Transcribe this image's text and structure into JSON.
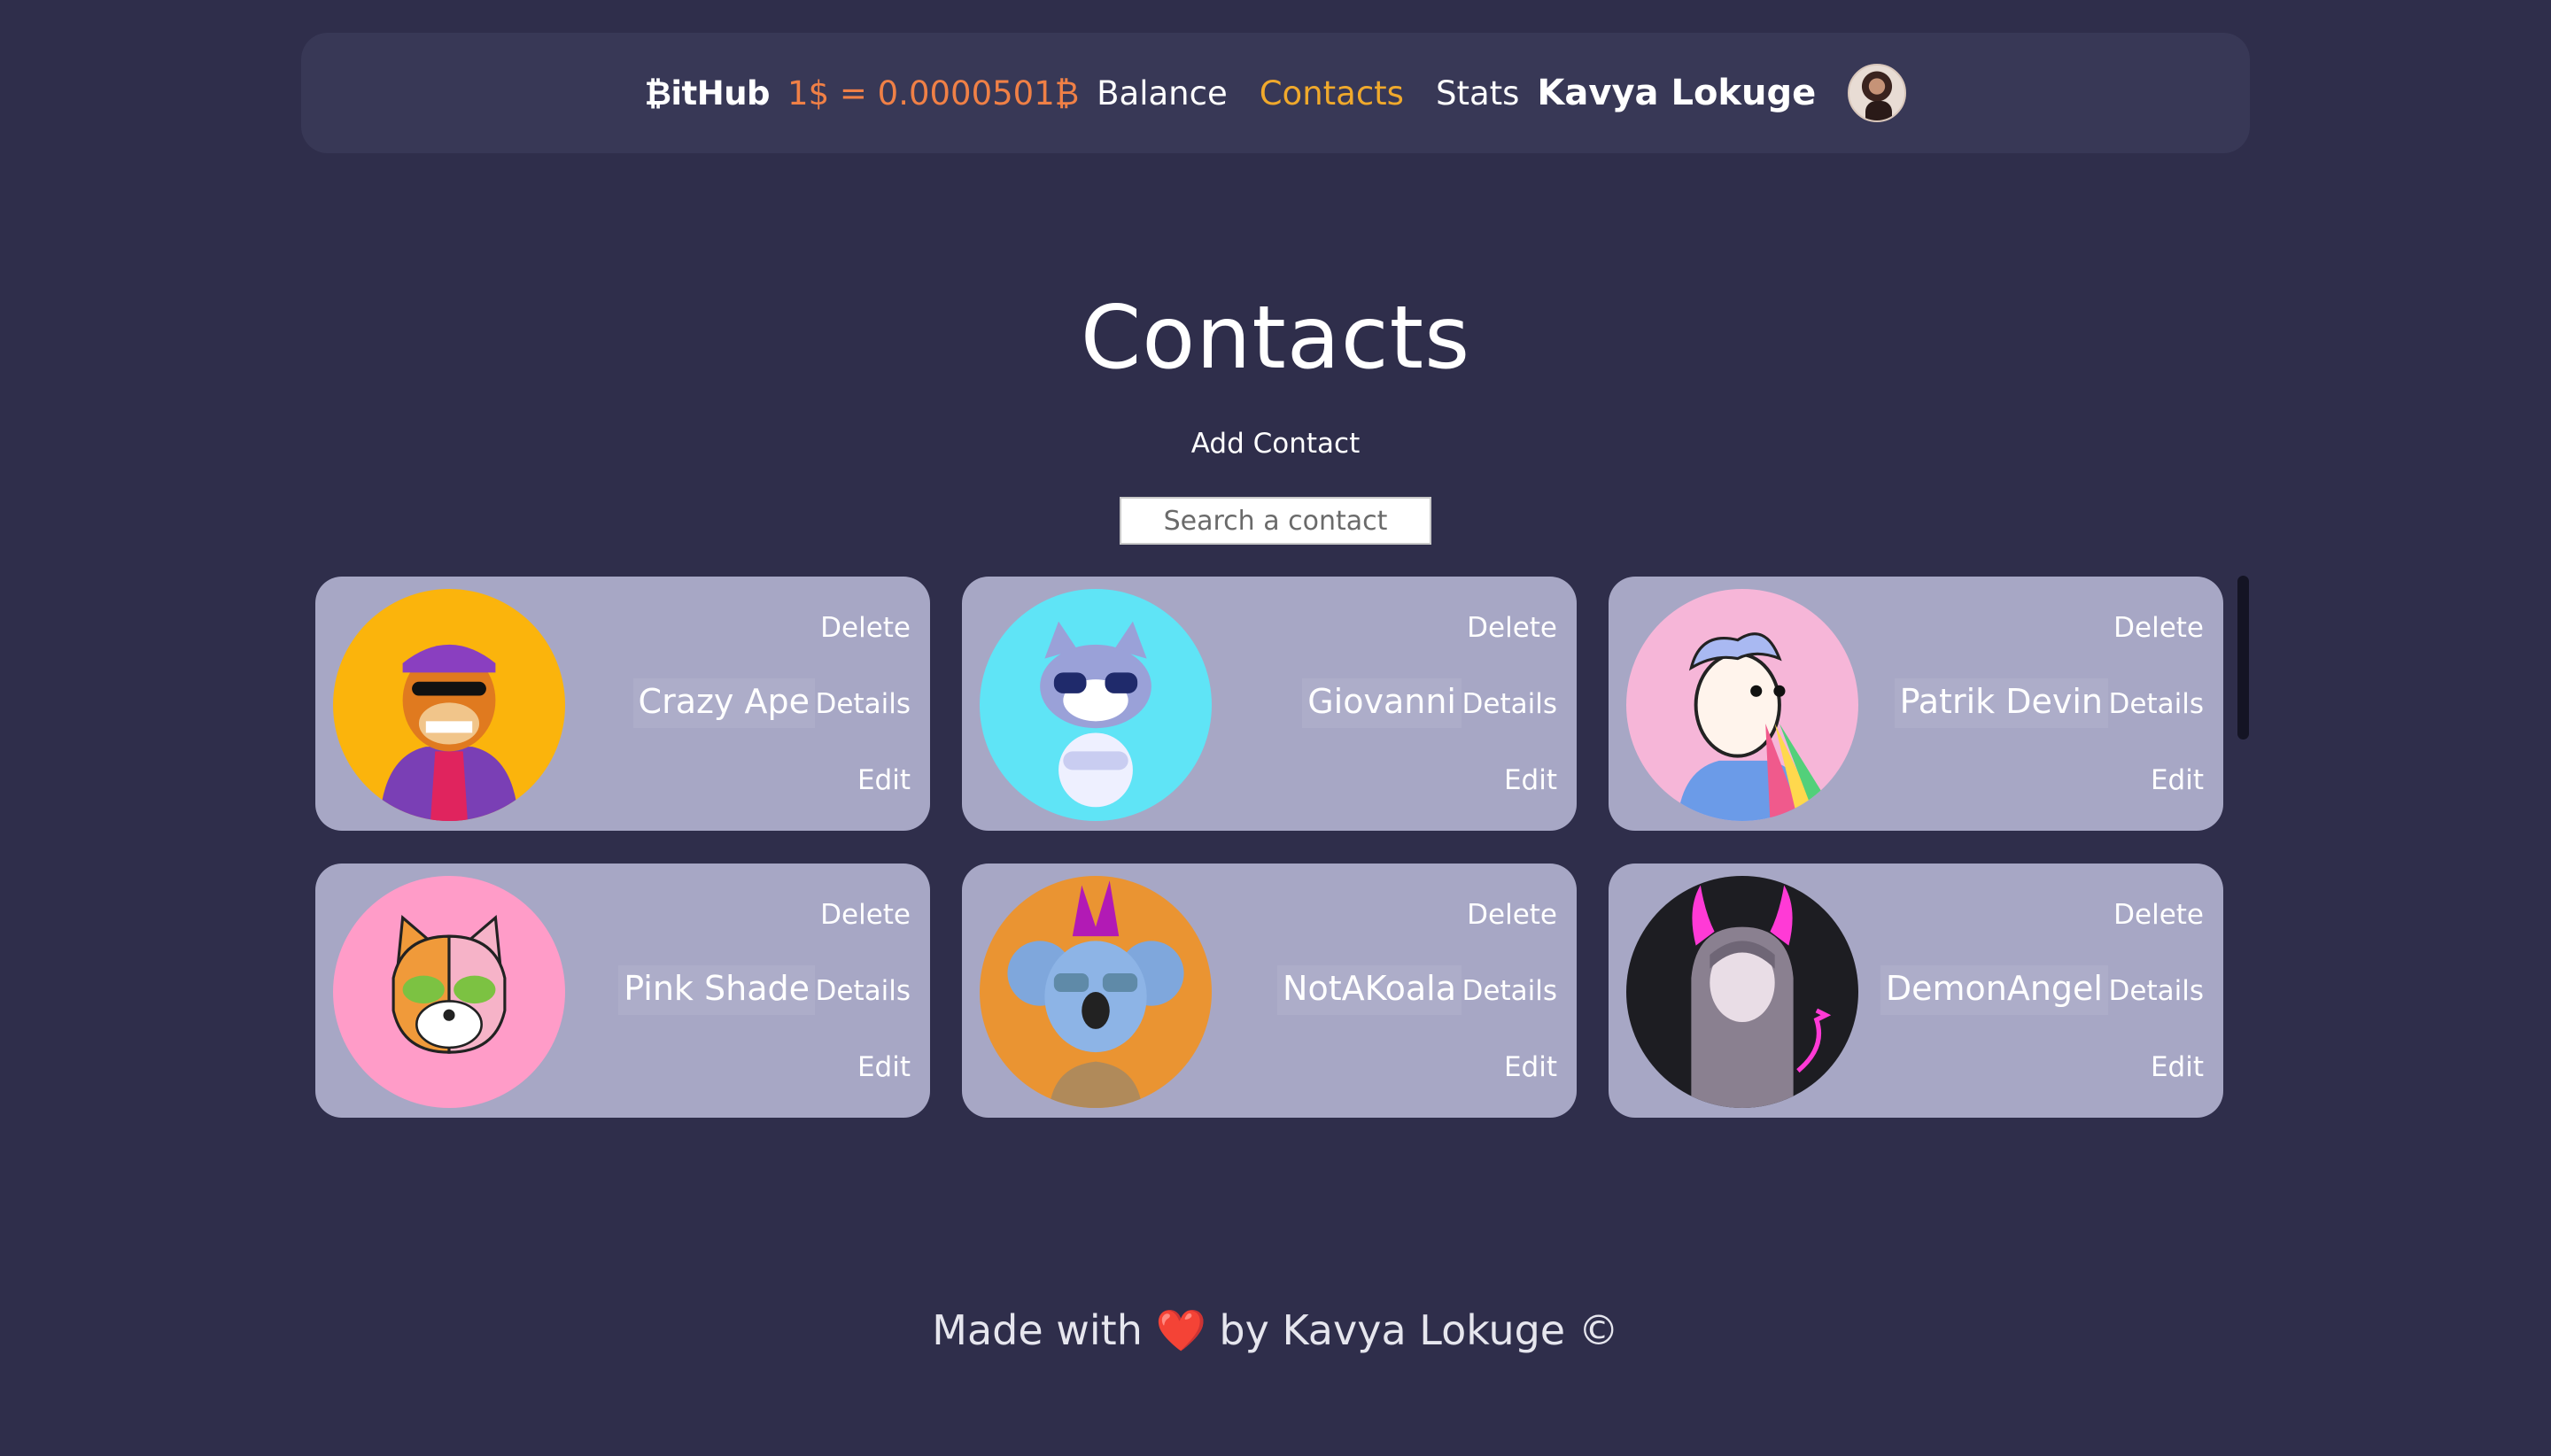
{
  "header": {
    "logo": "₿itHub",
    "rate": "1$ = 0.0000501₿",
    "nav": {
      "balance": "Balance",
      "contacts": "Contacts",
      "stats": "Stats"
    },
    "user_name": "Kavya Lokuge"
  },
  "main": {
    "title": "Contacts",
    "add_contact": "Add Contact",
    "search_placeholder": "Search a contact"
  },
  "contacts": [
    {
      "name": "Crazy Ape",
      "delete": "Delete",
      "details": "Details",
      "edit": "Edit",
      "avatar_bg": "#fbb40c"
    },
    {
      "name": "Giovanni",
      "delete": "Delete",
      "details": "Details",
      "edit": "Edit",
      "avatar_bg": "#5fe4f6"
    },
    {
      "name": "Patrik Devin",
      "delete": "Delete",
      "details": "Details",
      "edit": "Edit",
      "avatar_bg": "#f6b6d8"
    },
    {
      "name": "Pink Shade",
      "delete": "Delete",
      "details": "Details",
      "edit": "Edit",
      "avatar_bg": "#ff9cc8"
    },
    {
      "name": "NotAKoala",
      "delete": "Delete",
      "details": "Details",
      "edit": "Edit",
      "avatar_bg": "#ea9432"
    },
    {
      "name": "DemonAngel",
      "delete": "Delete",
      "details": "Details",
      "edit": "Edit",
      "avatar_bg": "#1d1d22"
    }
  ],
  "footer": {
    "prefix": "Made with",
    "heart": "❤️",
    "suffix": "by Kavya Lokuge ©"
  },
  "colors": {
    "background": "#2f2e4b",
    "navbar": "#383856",
    "card": "#a7a7c5",
    "rate": "#f08046",
    "active_link": "#f0a92c"
  }
}
